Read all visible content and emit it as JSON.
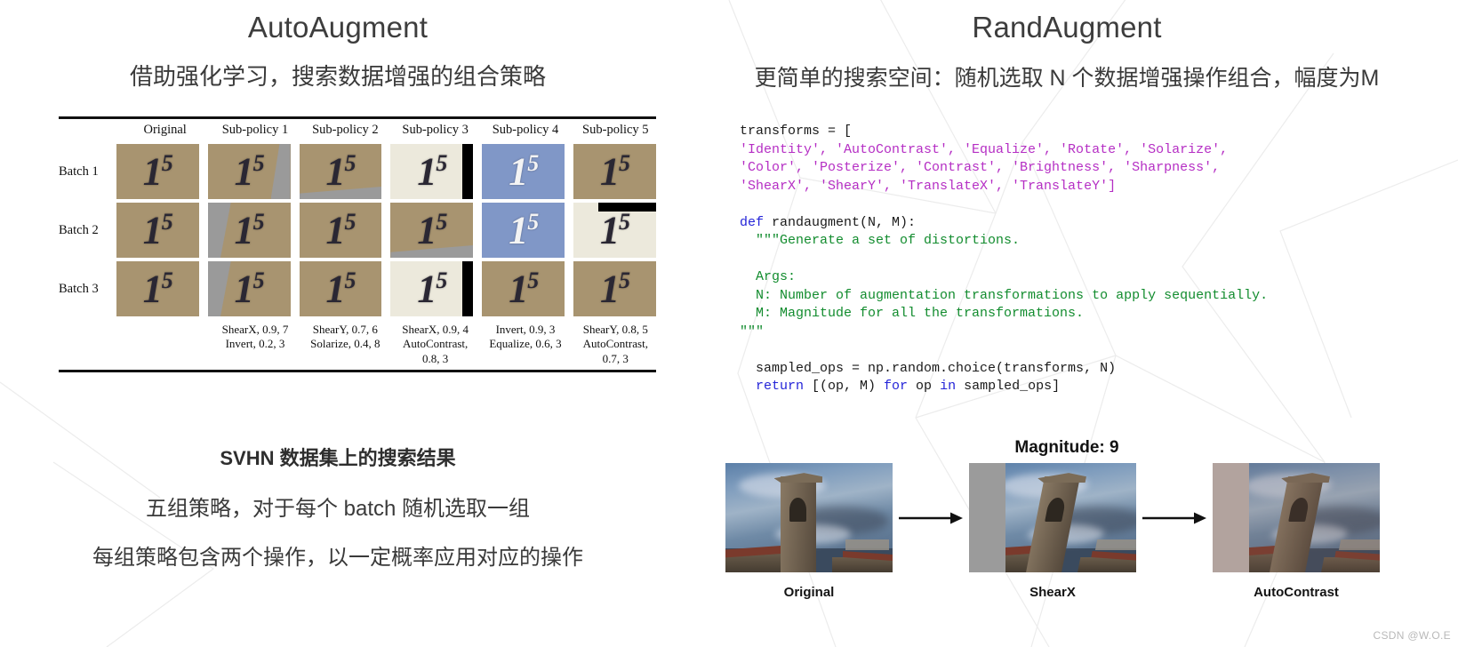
{
  "left": {
    "title_en": "AutoAugment",
    "title_cn": "借助强化学习，搜索数据增强的组合策略",
    "figure": {
      "column_headers": [
        "Original",
        "Sub-policy 1",
        "Sub-policy 2",
        "Sub-policy 3",
        "Sub-policy 4",
        "Sub-policy 5"
      ],
      "row_labels": [
        "Batch 1",
        "Batch 2",
        "Batch 3"
      ],
      "sample_label": "15",
      "operations": [
        {
          "line1": "",
          "line2": ""
        },
        {
          "line1": "ShearX, 0.9, 7",
          "line2": "Invert, 0.2, 3"
        },
        {
          "line1": "ShearY, 0.7, 6",
          "line2": "Solarize, 0.4, 8"
        },
        {
          "line1": "ShearX, 0.9, 4",
          "line2": "AutoContrast, 0.8, 3"
        },
        {
          "line1": "Invert, 0.9, 3",
          "line2": "Equalize, 0.6, 3"
        },
        {
          "line1": "ShearY, 0.8, 5",
          "line2": "AutoContrast, 0.7, 3"
        }
      ]
    },
    "notes": {
      "heading": "SVHN 数据集上的搜索结果",
      "line1": "五组策略，对于每个 batch 随机选取一组",
      "line2": "每组策略包含两个操作，以一定概率应用对应的操作"
    }
  },
  "right": {
    "title_en": "RandAugment",
    "title_cn": "更简单的搜索空间：随机选取 N 个数据增强操作组合，幅度为M",
    "code": {
      "l1_plain": "transforms = [",
      "l2_strings": "'Identity', 'AutoContrast', 'Equalize', 'Rotate', 'Solarize',",
      "l3_strings": "'Color', 'Posterize', 'Contrast', 'Brightness', 'Sharpness',",
      "l4_strings": "'ShearX', 'ShearY', 'TranslateX', 'TranslateY']",
      "l5_kw": "def",
      "l5_plain": " randaugment(N, M):",
      "l6_doc": "  \"\"\"Generate a set of distortions.",
      "l7_doc": "  Args:",
      "l8_doc": "  N: Number of augmentation transformations to apply sequentially.",
      "l9_doc": "  M: Magnitude for all the transformations.",
      "l10_doc": "\"\"\"",
      "l11_plain": "  sampled_ops = np.random.choice(transforms, N)",
      "l12_kw_return": "  return",
      "l12_mid": " [(op, M) ",
      "l12_kw_for": "for",
      "l12_mid2": " op ",
      "l12_kw_in": "in",
      "l12_tail": " sampled_ops]"
    },
    "magnitude_title": "Magnitude: 9",
    "photos": [
      {
        "caption": "Original"
      },
      {
        "caption": "ShearX"
      },
      {
        "caption": "AutoContrast"
      }
    ]
  },
  "watermark": "CSDN @W.O.E",
  "colors": {
    "string_token": "#b52ec4",
    "keyword_token": "#2424d8",
    "docstring_token": "#128c2e",
    "text": "#3a3a3a"
  }
}
